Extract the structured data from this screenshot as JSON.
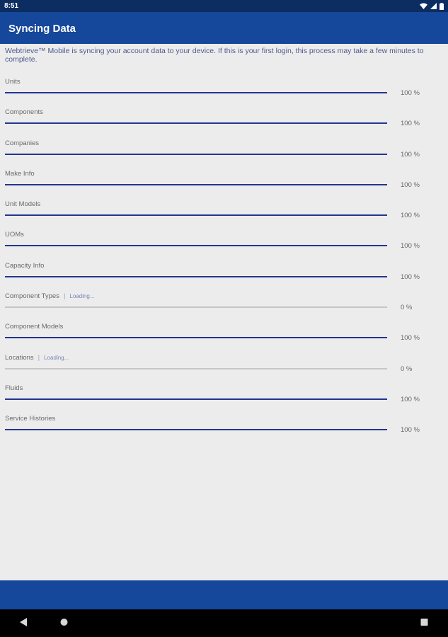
{
  "status_bar": {
    "time": "8:51"
  },
  "app_bar": {
    "title": "Syncing Data"
  },
  "intro_text": "Webtrieve™ Mobile is syncing your account data to your device. If this is your first login, this process may take a few minutes to complete.",
  "colors": {
    "status_bar": "#0c2d62",
    "app_bar": "#15479a",
    "progress_fill": "#23358f",
    "progress_track": "#c6c6c6",
    "background": "#ececec"
  },
  "icons": [
    "wifi-icon",
    "signal-icon",
    "battery-icon",
    "back-icon",
    "home-icon",
    "recents-icon"
  ],
  "sync_items": [
    {
      "label": "Units",
      "status": "",
      "percent_text": "100 %",
      "progress": 1
    },
    {
      "label": "Components",
      "status": "",
      "percent_text": "100 %",
      "progress": 1
    },
    {
      "label": "Companies",
      "status": "",
      "percent_text": "100 %",
      "progress": 1
    },
    {
      "label": "Make Info",
      "status": "",
      "percent_text": "100 %",
      "progress": 1
    },
    {
      "label": "Unit Models",
      "status": "",
      "percent_text": "100 %",
      "progress": 1
    },
    {
      "label": "UOMs",
      "status": "",
      "percent_text": "100 %",
      "progress": 1
    },
    {
      "label": "Capacity Info",
      "status": "",
      "percent_text": "100 %",
      "progress": 1
    },
    {
      "label": "Component Types",
      "status": "Loading...",
      "percent_text": "0 %",
      "progress": 0
    },
    {
      "label": "Component Models",
      "status": "",
      "percent_text": "100 %",
      "progress": 1
    },
    {
      "label": "Locations",
      "status": "Loading...",
      "percent_text": "0 %",
      "progress": 0
    },
    {
      "label": "Fluids",
      "status": "",
      "percent_text": "100 %",
      "progress": 1
    },
    {
      "label": "Service Histories",
      "status": "",
      "percent_text": "100 %",
      "progress": 1
    }
  ]
}
